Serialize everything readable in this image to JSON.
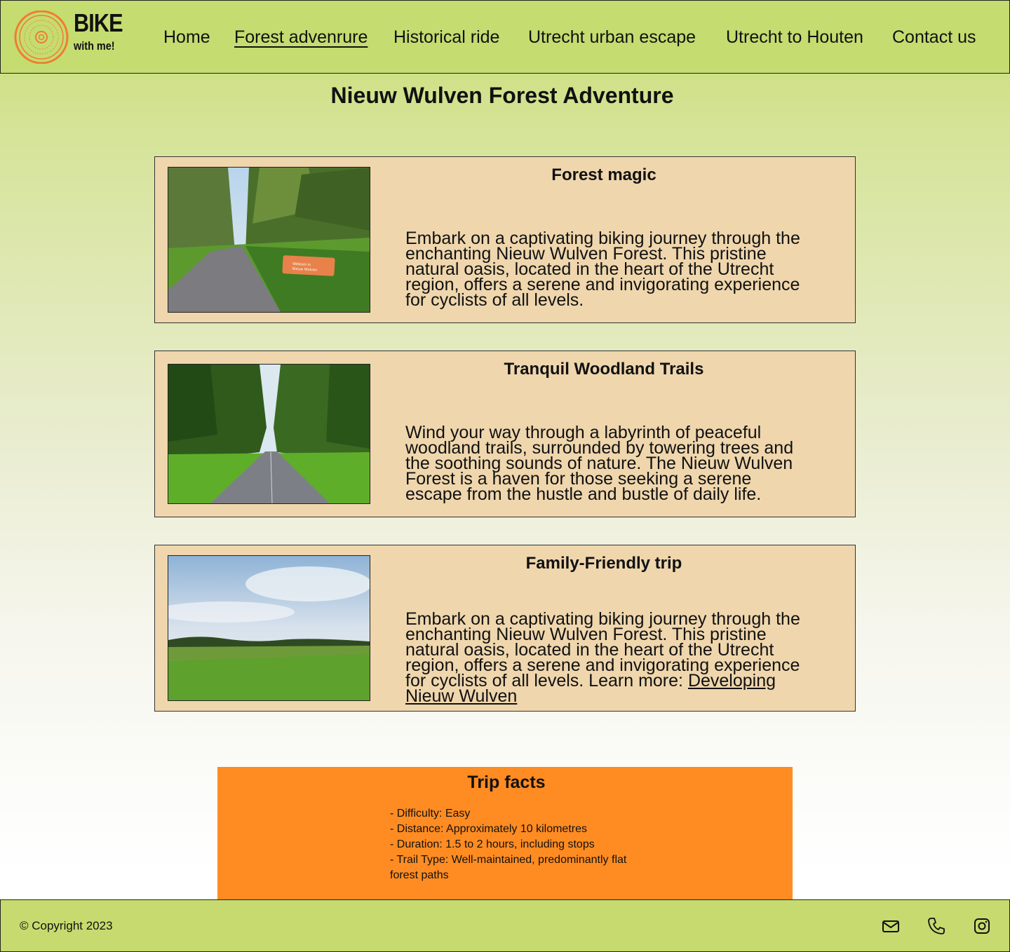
{
  "brand": {
    "title": "BIKE",
    "tagline": "with me!"
  },
  "nav": {
    "items": [
      {
        "label": "Home"
      },
      {
        "label": "Forest advenrure",
        "active": true
      },
      {
        "label": "Historical ride"
      },
      {
        "label": "Utrecht urban escape"
      },
      {
        "label": "Utrecht to Houten"
      },
      {
        "label": "Contact us"
      }
    ]
  },
  "page": {
    "title": "Nieuw Wulven Forest Adventure"
  },
  "cards": [
    {
      "title": "Forest magic",
      "text": "Embark on a captivating biking journey through the enchanting Nieuw Wulven Forest. This pristine natural oasis, located in the heart of the Utrecht region, offers a serene and invigorating experience for cyclists of all levels.",
      "photo": "forest-path-with-welcome-sign",
      "sign_text": "Welkom in Nieuw Wulven"
    },
    {
      "title": "Tranquil Woodland Trails",
      "text": "Wind your way through a labyrinth of peaceful woodland trails, surrounded by towering trees and the soothing sounds of nature. The Nieuw Wulven Forest is a haven for those seeking a serene escape from the hustle and bustle of daily life.",
      "photo": "paved-path-through-woods"
    },
    {
      "title": "Family-Friendly trip",
      "text": "Embark on a captivating biking journey through the enchanting Nieuw Wulven Forest. This pristine natural oasis, located in the heart of the Utrecht region, offers a serene and invigorating experience for cyclists of all levels. Learn more:",
      "link": "Developing Nieuw Wulven",
      "photo": "open-meadow-under-cloudy-sky"
    }
  ],
  "facts": {
    "title": "Trip facts",
    "items": [
      "- Difficulty: Easy",
      "- Distance: Approximately 10 kilometres",
      "- Duration: 1.5 to 2 hours, including stops",
      "- Trail Type: Well-maintained, predominantly flat forest paths"
    ]
  },
  "footer": {
    "copyright": "© Copyright 2023",
    "icons": [
      "mail-icon",
      "phone-icon",
      "instagram-icon"
    ]
  },
  "colors": {
    "header": "#c4dc70",
    "card": "#efd6ad",
    "facts": "#ff8c22",
    "logo": "#f07c30"
  }
}
